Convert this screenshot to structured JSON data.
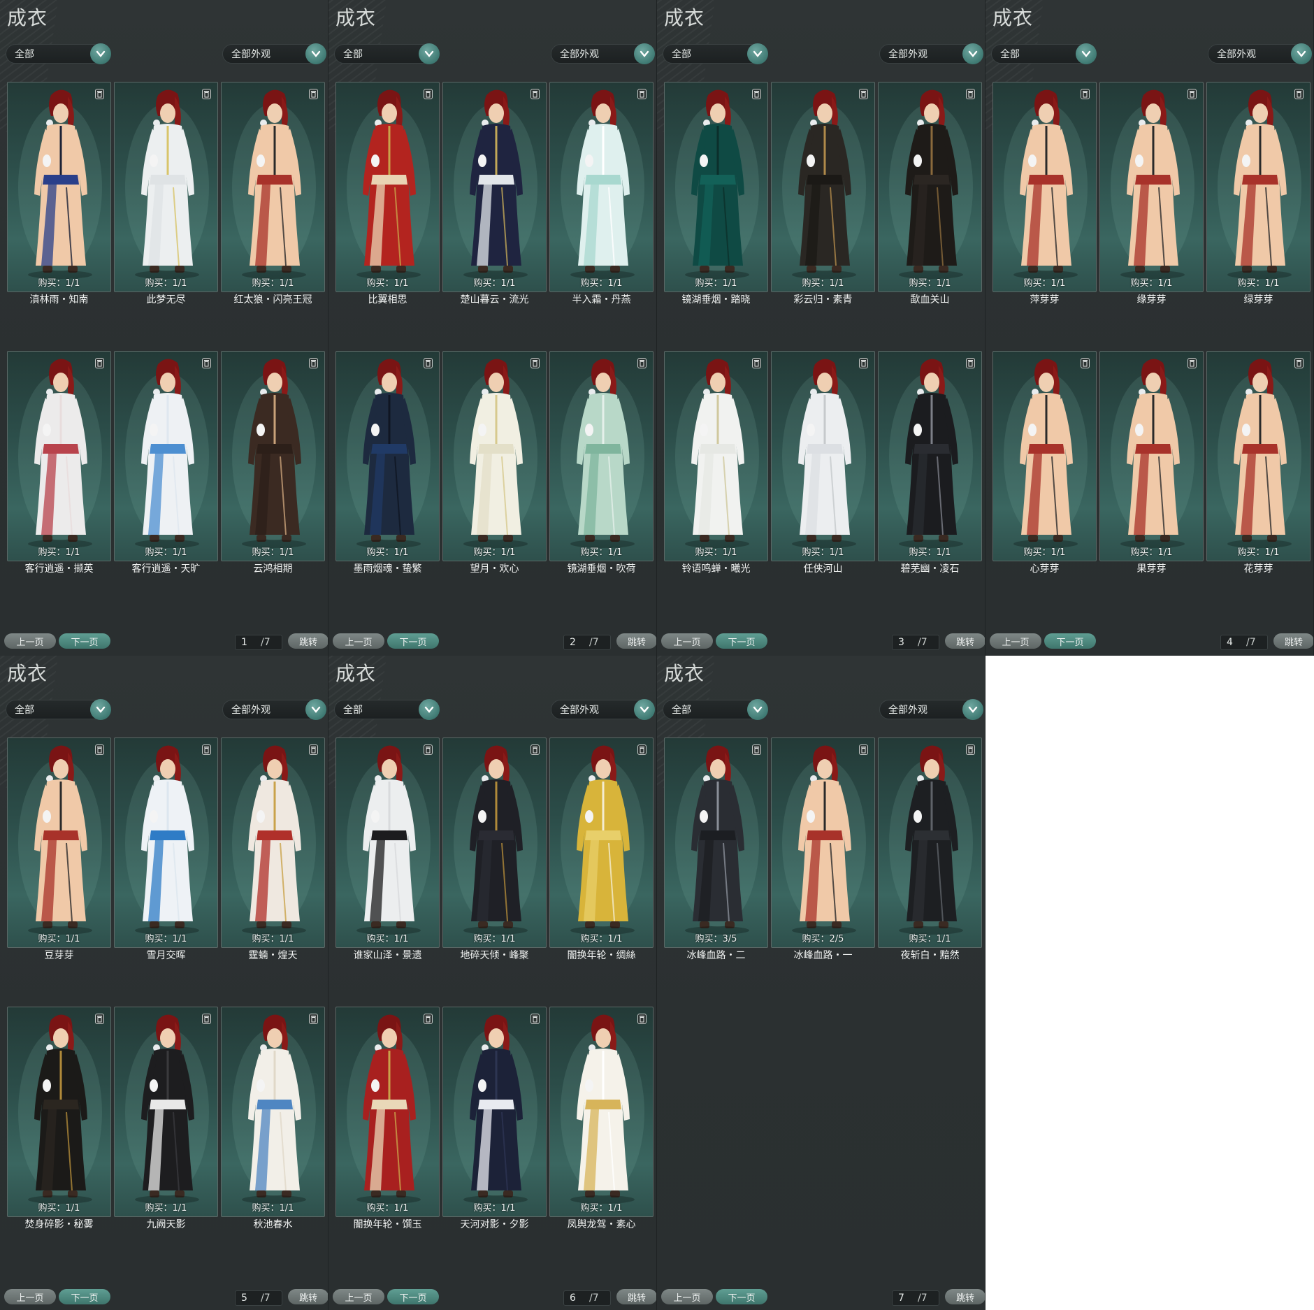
{
  "panels": [
    {
      "title": "成衣",
      "category": "全部",
      "appearance": "全部外观",
      "items": [
        {
          "name": "滇林雨・知南",
          "buy": "购买：1/1",
          "colors": [
            "#f0c9a8",
            "#2a3f8a",
            "#1c2236"
          ]
        },
        {
          "name": "此梦无尽",
          "buy": "购买：1/1",
          "colors": [
            "#eceff0",
            "#dfe3e5",
            "#d8c46a"
          ]
        },
        {
          "name": "红太狼・闪亮王冠",
          "buy": "购买：1/1",
          "colors": [
            "#f0c9a8",
            "#a8322a",
            "#2a2a2a"
          ]
        },
        {
          "name": "客行逍遥・撷英",
          "buy": "购买：1/1",
          "colors": [
            "#ecebeb",
            "#b8434c",
            "#e8dcdc"
          ]
        },
        {
          "name": "客行逍遥・天旷",
          "buy": "购买：1/1",
          "colors": [
            "#eef1f4",
            "#4d8fd1",
            "#dfe7ef"
          ]
        },
        {
          "name": "云鸿相期",
          "buy": "购买：1/1",
          "colors": [
            "#3b2a22",
            "#2c1f19",
            "#caa27a"
          ]
        }
      ],
      "prev": "上一页",
      "next": "下一页",
      "page": "1",
      "total": "/7",
      "jump": "跳转"
    },
    {
      "title": "成衣",
      "category": "全部",
      "appearance": "全部外观",
      "items": [
        {
          "name": "比翼相思",
          "buy": "购买：1/1",
          "colors": [
            "#b3241f",
            "#e9d4b4",
            "#c9a24a"
          ]
        },
        {
          "name": "楚山暮云・流光",
          "buy": "购买：1/1",
          "colors": [
            "#1f2440",
            "#e2e6ea",
            "#c2a858"
          ]
        },
        {
          "name": "半入霜・丹燕",
          "buy": "购买：1/1",
          "colors": [
            "#dff0ee",
            "#a8d8cf",
            "#ffffff"
          ]
        },
        {
          "name": "墨雨烟魂・蛰繁",
          "buy": "购买：1/1",
          "colors": [
            "#1d2a3f",
            "#203a66",
            "#0f1522"
          ]
        },
        {
          "name": "望月・欢心",
          "buy": "购买：1/1",
          "colors": [
            "#f1efe2",
            "#e3dfc8",
            "#d7c98e"
          ]
        },
        {
          "name": "镜湖垂烟・吹荷",
          "buy": "购买：1/1",
          "colors": [
            "#b8d8c8",
            "#7fb59d",
            "#e4f0ea"
          ]
        }
      ],
      "prev": "上一页",
      "next": "下一页",
      "page": "2",
      "total": "/7",
      "jump": "跳转"
    },
    {
      "title": "成衣",
      "category": "全部",
      "appearance": "全部外观",
      "items": [
        {
          "name": "镜湖垂烟・踏晓",
          "buy": "购买：1/1",
          "colors": [
            "#0f4a44",
            "#136158",
            "#0b2f2b"
          ]
        },
        {
          "name": "彩云归・素青",
          "buy": "购买：1/1",
          "colors": [
            "#2a2723",
            "#1b1916",
            "#b08a4a"
          ]
        },
        {
          "name": "歃血关山",
          "buy": "购买：1/1",
          "colors": [
            "#1e1b18",
            "#2b2622",
            "#8a6a3c"
          ]
        },
        {
          "name": "铃语鸣蝉・曦光",
          "buy": "购买：1/1",
          "colors": [
            "#f1f2f0",
            "#e6e8e4",
            "#d0c89e"
          ]
        },
        {
          "name": "任侠河山",
          "buy": "购买：1/1",
          "colors": [
            "#eceef0",
            "#dcdfe3",
            "#c6c9cc"
          ]
        },
        {
          "name": "碧芜幽・凌石",
          "buy": "购买：1/1",
          "colors": [
            "#1b1c1f",
            "#2a2c31",
            "#7d8088"
          ]
        }
      ],
      "prev": "上一页",
      "next": "下一页",
      "page": "3",
      "total": "/7",
      "jump": "跳转"
    },
    {
      "title": "成衣",
      "category": "全部",
      "appearance": "全部外观",
      "items": [
        {
          "name": "萍芽芽",
          "buy": "购买：1/1",
          "colors": [
            "#f0c9a8",
            "#a8322a",
            "#2a2a2a"
          ]
        },
        {
          "name": "缘芽芽",
          "buy": "购买：1/1",
          "colors": [
            "#f0c9a8",
            "#a8322a",
            "#2a2a2a"
          ]
        },
        {
          "name": "绿芽芽",
          "buy": "购买：1/1",
          "colors": [
            "#f0c9a8",
            "#a8322a",
            "#2a2a2a"
          ]
        },
        {
          "name": "心芽芽",
          "buy": "购买：1/1",
          "colors": [
            "#f0c9a8",
            "#a8322a",
            "#2a2a2a"
          ]
        },
        {
          "name": "果芽芽",
          "buy": "购买：1/1",
          "colors": [
            "#f0c9a8",
            "#a8322a",
            "#2a2a2a"
          ]
        },
        {
          "name": "花芽芽",
          "buy": "购买：1/1",
          "colors": [
            "#f0c9a8",
            "#a8322a",
            "#2a2a2a"
          ]
        }
      ],
      "prev": "上一页",
      "next": "下一页",
      "page": "4",
      "total": "/7",
      "jump": "跳转"
    },
    {
      "title": "成衣",
      "category": "全部",
      "appearance": "全部外观",
      "items": [
        {
          "name": "豆芽芽",
          "buy": "购买：1/1",
          "colors": [
            "#f0c9a8",
            "#a8322a",
            "#2a2a2a"
          ]
        },
        {
          "name": "雪月交晖",
          "buy": "购买：1/1",
          "colors": [
            "#eef2f6",
            "#2f7cc6",
            "#dce6ef"
          ]
        },
        {
          "name": "霆蝻・煌天",
          "buy": "购买：1/1",
          "colors": [
            "#efe8e0",
            "#b0302a",
            "#c9a24a"
          ]
        },
        {
          "name": "焚身碎影・秘雾",
          "buy": "购买：1/1",
          "colors": [
            "#1b1a18",
            "#2b2620",
            "#b08a3a"
          ]
        },
        {
          "name": "九阙天影",
          "buy": "购买：1/1",
          "colors": [
            "#1d1d1f",
            "#e8e8e8",
            "#3a3a3d"
          ]
        },
        {
          "name": "秋池春水",
          "buy": "购买：1/1",
          "colors": [
            "#f2efe8",
            "#4f86c2",
            "#e0d8c8"
          ]
        }
      ],
      "prev": "上一页",
      "next": "下一页",
      "page": "5",
      "total": "/7",
      "jump": "跳转"
    },
    {
      "title": "成衣",
      "category": "全部",
      "appearance": "全部外观",
      "items": [
        {
          "name": "谁家山泽・景遗",
          "buy": "购买：1/1",
          "colors": [
            "#eceeef",
            "#1c1c1e",
            "#d8dadc"
          ]
        },
        {
          "name": "地碎天倾・峰聚",
          "buy": "购买：1/1",
          "colors": [
            "#1f2026",
            "#2a2b33",
            "#b08a3a"
          ]
        },
        {
          "name": "闇换年轮・绸絲",
          "buy": "购买：1/1",
          "colors": [
            "#d8b43a",
            "#e8cf6a",
            "#f4ecd0"
          ]
        },
        {
          "name": "闇换年轮・馔玉",
          "buy": "购买：1/1",
          "colors": [
            "#a8201f",
            "#e9d8b8",
            "#c9a24a"
          ]
        },
        {
          "name": "天河对影・夕影",
          "buy": "购买：1/1",
          "colors": [
            "#1c2238",
            "#e8eaf0",
            "#2d3552"
          ]
        },
        {
          "name": "凤舆龙驾・素心",
          "buy": "购买：1/1",
          "colors": [
            "#f5f2ea",
            "#d7b45a",
            "#ffffff"
          ]
        }
      ],
      "prev": "上一页",
      "next": "下一页",
      "page": "6",
      "total": "/7",
      "jump": "跳转"
    },
    {
      "title": "成衣",
      "category": "全部",
      "appearance": "全部外观",
      "items": [
        {
          "name": "冰峰血路・二",
          "buy": "购买：3/5",
          "colors": [
            "#2a2d33",
            "#1c1e22",
            "#8a8f98"
          ]
        },
        {
          "name": "冰峰血路・一",
          "buy": "购买：2/5",
          "colors": [
            "#f0c9a8",
            "#a8322a",
            "#2a2a2a"
          ]
        },
        {
          "name": "夜斩白・黯然",
          "buy": "购买：1/1",
          "colors": [
            "#1d1f22",
            "#2c2f33",
            "#5f6369"
          ]
        }
      ],
      "prev": "上一页",
      "next": "下一页",
      "page": "7",
      "total": "/7",
      "jump": "跳转"
    }
  ]
}
